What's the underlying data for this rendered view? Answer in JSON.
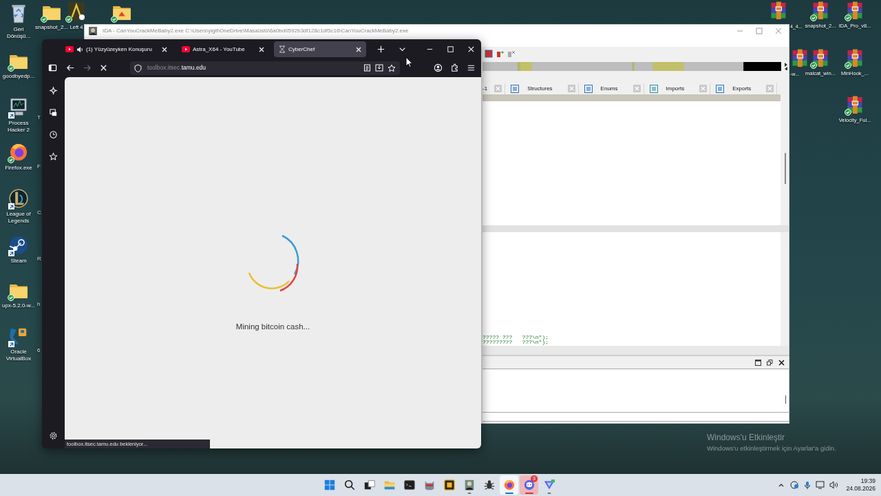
{
  "desktop": {
    "left_icons": [
      {
        "label": "Geri Dönüşü...",
        "kind": "recycle-bin",
        "synced": false,
        "shortcut": false
      },
      {
        "label": "goodbyedp...",
        "kind": "folder",
        "synced": true,
        "shortcut": false
      },
      {
        "label": "Process Hacker 2",
        "kind": "process-hacker",
        "synced": false,
        "shortcut": true
      },
      {
        "label": "Firefox.exe",
        "kind": "firefox",
        "synced": true,
        "shortcut": false
      },
      {
        "label": "League of Legends",
        "kind": "league",
        "synced": false,
        "shortcut": true
      },
      {
        "label": "Steam",
        "kind": "steam",
        "synced": false,
        "shortcut": true
      },
      {
        "label": "upx-5.2.0-w...",
        "kind": "folder",
        "synced": true,
        "shortcut": false
      },
      {
        "label": "Oracle VirtualBox",
        "kind": "virtualbox",
        "synced": false,
        "shortcut": true
      }
    ],
    "second_column_labels": [
      "T",
      "F",
      "C",
      "R",
      "h",
      "6"
    ],
    "top_icons": [
      {
        "label": "snapshot_2...",
        "kind": "folder",
        "synced": true,
        "shortcut": false
      },
      {
        "label": "Left 4",
        "kind": "game",
        "synced": true,
        "shortcut": false
      },
      {
        "kind": "folder-red",
        "synced": true,
        "shortcut": false
      }
    ],
    "right_icons": [
      {
        "label": "4_4...",
        "kind": "archive",
        "synced": false,
        "shortcut": false
      },
      {
        "label": "snapshot_2...",
        "kind": "archive",
        "synced": true,
        "shortcut": false
      },
      {
        "label": "IDA_Pro_v8...",
        "kind": "archive",
        "synced": true,
        "shortcut": false
      },
      {
        "label": "-w...",
        "kind": "archive",
        "synced": false,
        "shortcut": false
      },
      {
        "label": "malcat_win...",
        "kind": "archive",
        "synced": true,
        "shortcut": false
      },
      {
        "label": "MinHook_...",
        "kind": "archive",
        "synced": true,
        "shortcut": false
      },
      {
        "label": "Velocity_Ful...",
        "kind": "archive",
        "synced": true,
        "shortcut": false
      }
    ],
    "activation_notice": {
      "title": "Windows'u Etkinleştir",
      "subtitle": "Windows'u etkinleştirmek için Ayarlar'a gidin."
    }
  },
  "ida_window": {
    "title": "IDA - CanYouCrackMeBaby2.exe C:\\Users\\yigit\\OneDrive\\Masaüstü\\6a0bd0592b3df128c1df5c16\\CanYouCrackMeBaby2.exe",
    "tabs": [
      {
        "label": "-1"
      },
      {
        "label": "Structures"
      },
      {
        "label": "Enums"
      },
      {
        "label": "Imports"
      },
      {
        "label": "Exports"
      }
    ],
    "code_lines": [
      "????? ???   ???\\n\");",
      "?????????   ???\\n\");"
    ]
  },
  "browser": {
    "tabs": [
      {
        "title": "(1) Yüzyüzeyken Konuşuru",
        "kind": "youtube",
        "audio": true,
        "selected": false
      },
      {
        "title": "Astra_X64 - YouTube",
        "kind": "youtube",
        "audio": false,
        "selected": false
      },
      {
        "title": "CyberChef",
        "kind": "cyberchef",
        "audio": false,
        "selected": true
      }
    ],
    "url": {
      "host_prefix": "toolbox.itsec.",
      "domain": "tamu.edu"
    },
    "loading": true,
    "forward_enabled": false,
    "message": "Mining bitcoin cash...",
    "status": "toolbox.itsec.tamu.edu bekleniyor..."
  },
  "taskbar": {
    "items": [
      {
        "kind": "windows",
        "running": false,
        "focused": false,
        "flashing": false
      },
      {
        "kind": "search",
        "running": false,
        "focused": false,
        "flashing": false
      },
      {
        "kind": "task-view",
        "running": false,
        "focused": false,
        "flashing": false
      },
      {
        "kind": "explorer",
        "running": false,
        "focused": false,
        "flashing": false
      },
      {
        "kind": "terminal",
        "running": false,
        "focused": false,
        "flashing": false
      },
      {
        "kind": "cat",
        "running": false,
        "focused": false,
        "flashing": false
      },
      {
        "kind": "square-app",
        "running": false,
        "focused": false,
        "flashing": false
      },
      {
        "kind": "portrait",
        "running": true,
        "focused": false,
        "flashing": false
      },
      {
        "kind": "bug",
        "running": false,
        "focused": false,
        "flashing": false
      },
      {
        "kind": "firefox",
        "running": true,
        "focused": true,
        "flashing": false
      },
      {
        "kind": "chat",
        "running": true,
        "focused": false,
        "flashing": true,
        "badge": "3"
      },
      {
        "kind": "vpn",
        "running": true,
        "focused": false,
        "flashing": false
      }
    ],
    "clock": {
      "time": "19:39",
      "date": "24.08.2026"
    }
  }
}
